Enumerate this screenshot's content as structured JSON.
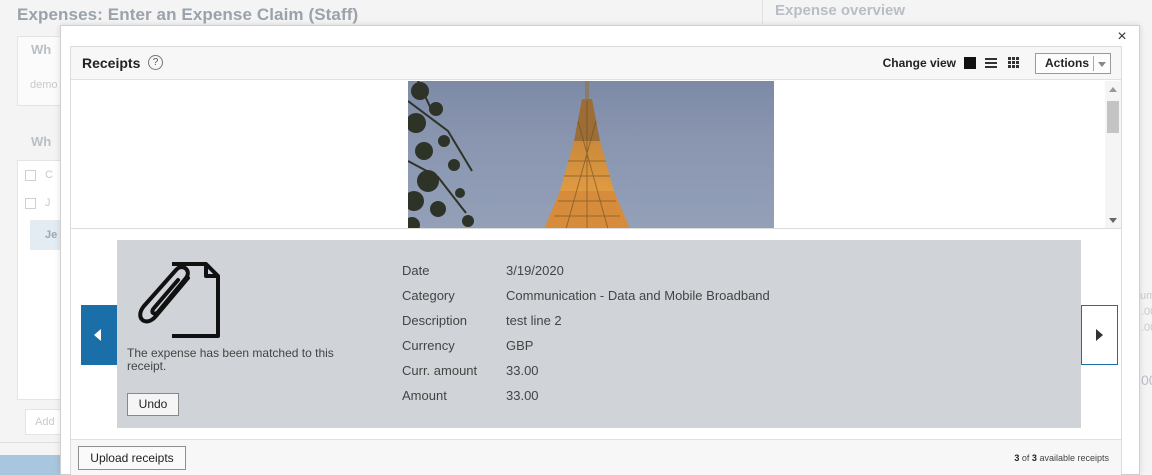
{
  "background": {
    "page_title": "Expenses: Enter an Expense Claim (Staff)",
    "overview_title": "Expense overview",
    "section_what_1": "Wh",
    "demo_text": "demo",
    "section_what_2": "Wh",
    "row_c": "C",
    "row_j": "J",
    "row_je": "Je",
    "add_text": "Add",
    "right_col_1": "um",
    "right_col_2": ".00",
    "right_col_3": ".00",
    "right_col_4": "00"
  },
  "modal": {
    "close_label": "×",
    "title": "Receipts",
    "help_label": "?",
    "change_view_label": "Change view",
    "actions_label": "Actions",
    "upload_label": "Upload receipts",
    "count": {
      "current": "3",
      "of_label": "of",
      "total": "3",
      "suffix": "available receipts"
    }
  },
  "receipt": {
    "matched_message": "The expense has been matched to this receipt.",
    "undo_label": "Undo",
    "fields": [
      {
        "label": "Date",
        "value": "3/19/2020"
      },
      {
        "label": "Category",
        "value": "Communication - Data and Mobile Broadband"
      },
      {
        "label": "Description",
        "value": "test line 2"
      },
      {
        "label": "Currency",
        "value": "GBP"
      },
      {
        "label": "Curr. amount",
        "value": "33.00"
      },
      {
        "label": "Amount",
        "value": "33.00"
      }
    ]
  },
  "icons": {
    "close": "close-icon",
    "help": "help-icon",
    "view_single": "single-view-icon",
    "view_list": "list-view-icon",
    "view_grid": "grid-view-icon",
    "receipt": "paperclip-document-icon",
    "prev": "chevron-left-icon",
    "next": "chevron-right-icon"
  },
  "colors": {
    "accent": "#1a6fa8",
    "details_bg": "#d0d4d8"
  }
}
